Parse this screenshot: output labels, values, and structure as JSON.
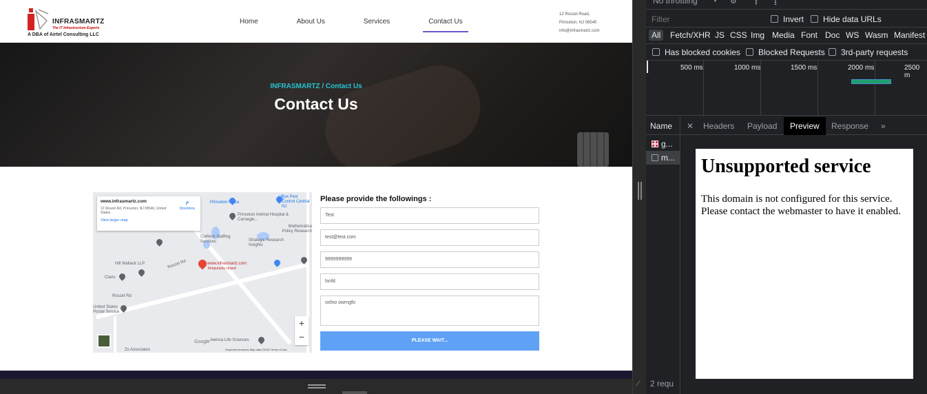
{
  "site": {
    "logo": {
      "name": "INFRASMARTZ",
      "tagline": "The IT Infrastructure Experts",
      "dba": "A DBA of Airtel Consulting LLC"
    },
    "nav": [
      "Home",
      "About Us",
      "Services",
      "Contact Us"
    ],
    "active_nav": "Contact Us",
    "address": [
      "12 Roszel Road,",
      "Princeton, NJ 08540",
      "info@infrasmartz.com"
    ],
    "hero": {
      "breadcrumb": "INFRASMARTZ / Contact Us",
      "title": "Contact Us"
    },
    "map": {
      "card_title": "www.infrasmartz.com",
      "card_address": "12 Roszel Rd, Princeton, NJ 08540, United States",
      "card_link": "View larger map",
      "directions": "Directions",
      "pin_label": "www.infrasmartz.com",
      "pin_status": "Temporarily closed",
      "labels": [
        "Princeton Plaza",
        "Fox Pest Control Central NJ",
        "Princeton Animal Hospital & Carnegie...",
        "Mathematica Policy Research",
        "CoWork Staffing Services",
        "Strategic Research Insights",
        "Hill Wallack LLP",
        "Clario",
        "Roszel Rd",
        "Roszel Rd",
        "United States Postal Service",
        "Awinsa Life Sciences",
        "Zs Associates",
        "Google"
      ],
      "footer": "Keyboard shortcuts   Map data ©2022   Terms of Use"
    },
    "form": {
      "title": "Please provide the followings :",
      "fields": [
        "Test",
        "test@test.com",
        "9999999999",
        "lsnfd"
      ],
      "message": "osfno owrngfo",
      "submit": "PLEASE WAIT..."
    }
  },
  "devtools": {
    "throttling": "No throttling",
    "filter_placeholder": "Filter",
    "invert": "Invert",
    "hide_data_urls": "Hide data URLs",
    "types": [
      "All",
      "Fetch/XHR",
      "JS",
      "CSS",
      "Img",
      "Media",
      "Font",
      "Doc",
      "WS",
      "Wasm",
      "Manifest"
    ],
    "flags": [
      "Has blocked cookies",
      "Blocked Requests",
      "3rd-party requests"
    ],
    "ticks": [
      "500 ms",
      "1000 ms",
      "1500 ms",
      "2000 ms",
      "2500 m"
    ],
    "name_header": "Name",
    "requests": [
      "g...",
      "m..."
    ],
    "request_count": "2 requ",
    "tabs": [
      "Headers",
      "Payload",
      "Preview",
      "Response"
    ],
    "active_tab": "Preview",
    "preview": {
      "heading": "Unsupported service",
      "body": "This domain is not configured for this service. Please contact the webmaster to have it enabled."
    }
  }
}
